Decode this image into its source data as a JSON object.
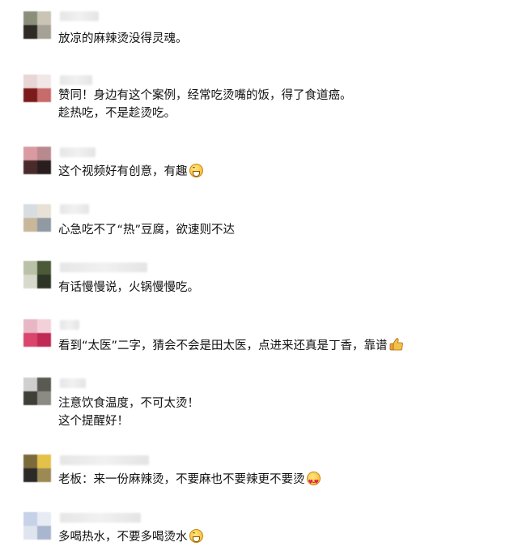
{
  "comments": [
    {
      "lines": [
        "放凉的麻辣烫没得灵魂。"
      ],
      "emoji": null,
      "avatar": [
        "#8a8f7a",
        "#c9c4b3",
        "#2f2b24",
        "#a6a196"
      ],
      "name_width": 48
    },
    {
      "lines": [
        "赞同！身边有这个案例，经常吃烫嘴的饭，得了食道癌。",
        "趁热吃，不是趁烫吃。"
      ],
      "emoji": null,
      "avatar": [
        "#e8d6d6",
        "#f2e7e7",
        "#7b1b1b",
        "#c86b6b"
      ],
      "name_width": 40
    },
    {
      "lines": [
        "这个视频好有创意，有趣"
      ],
      "emoji": "grin-icon",
      "avatar": [
        "#d99aa2",
        "#b88a8e",
        "#4a2b2b",
        "#2a1d1d"
      ],
      "name_width": 44
    },
    {
      "lines": [
        "心急吃不了“热”豆腐，欲速则不达"
      ],
      "emoji": null,
      "avatar": [
        "#d8dde2",
        "#e7e1d6",
        "#c9b79a",
        "#8f9aa3"
      ],
      "name_width": 36
    },
    {
      "lines": [
        "有话慢慢说，火锅慢慢吃。"
      ],
      "emoji": null,
      "avatar": [
        "#b9c2a8",
        "#4c5a3a",
        "#d6d9cc",
        "#2e3526"
      ],
      "name_width": 108
    },
    {
      "lines": [
        "看到“太医”二字，猜会不会是田太医，点进来还真是丁香，靠谱"
      ],
      "emoji": "thumbs-up-icon",
      "avatar": [
        "#e8b6c4",
        "#f4d0da",
        "#d9456c",
        "#c02a55"
      ],
      "name_width": 24
    },
    {
      "lines": [
        "注意饮食温度，不可太烫！",
        "这个提醒好！"
      ],
      "emoji": null,
      "avatar": [
        "#cfcfcf",
        "#5a5a52",
        "#3f3f38",
        "#8b8b84"
      ],
      "name_width": 32
    },
    {
      "lines": [
        "老板：来一份麻辣烫，不要麻也不要辣更不要烫"
      ],
      "emoji": "heart-eyes-icon",
      "avatar": [
        "#7b6a3a",
        "#e3c24a",
        "#2c2a26",
        "#9c8a55"
      ],
      "name_width": 110
    },
    {
      "lines": [
        "多喝热水，不要多喝烫水"
      ],
      "emoji": "grin-icon",
      "avatar": [
        "#c7d2e8",
        "#e6ebf4",
        "#dfe4ee",
        "#aab6cf"
      ],
      "name_width": 100
    }
  ]
}
